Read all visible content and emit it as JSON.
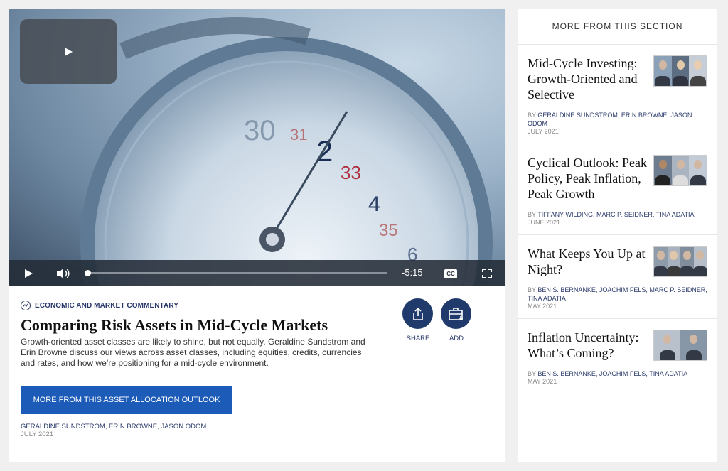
{
  "video": {
    "time_remaining": "-5:15",
    "cc_label": "CC",
    "progress": 0.0
  },
  "article": {
    "category": "ECONOMIC AND MARKET COMMENTARY",
    "title": "Comparing Risk Assets in Mid-Cycle Markets",
    "description": "Growth-oriented asset classes are likely to shine, but not equally. Geraldine Sundstrom and Erin Browne discuss our views across asset classes, including equities, credits, currencies and rates, and how we’re positioning for a mid-cycle environment.",
    "cta_label": "MORE FROM THIS ASSET ALLOCATION OUTLOOK",
    "authors": "GERALDINE SUNDSTROM, ERIN BROWNE, JASON ODOM",
    "date": "JULY 2021"
  },
  "actions": {
    "share_label": "SHARE",
    "add_label": "ADD"
  },
  "sidebar": {
    "heading": "MORE FROM THIS SECTION",
    "by_label": "BY",
    "items": [
      {
        "title": "Mid-Cycle Investing: Growth-Oriented and Selective",
        "authors": "GERALDINE SUNDSTROM, ERIN BROWNE, JASON ODOM",
        "date": "JULY 2021"
      },
      {
        "title": "Cyclical Outlook: Peak Policy, Peak Inflation, Peak Growth",
        "authors": "TIFFANY WILDING, MARC P. SEIDNER, TINA ADATIA",
        "date": "JUNE 2021"
      },
      {
        "title": "What Keeps You Up at Night?",
        "authors": "BEN S. BERNANKE, JOACHIM FELS, MARC P. SEIDNER, TINA ADATIA",
        "date": "MAY 2021"
      },
      {
        "title": "Inflation Uncertainty: What’s Coming?",
        "authors": "BEN S. BERNANKE, JOACHIM FELS, TINA ADATIA",
        "date": "MAY 2021"
      }
    ]
  },
  "colors": {
    "accent": "#1d5bb8",
    "navy": "#1f3a6b"
  }
}
